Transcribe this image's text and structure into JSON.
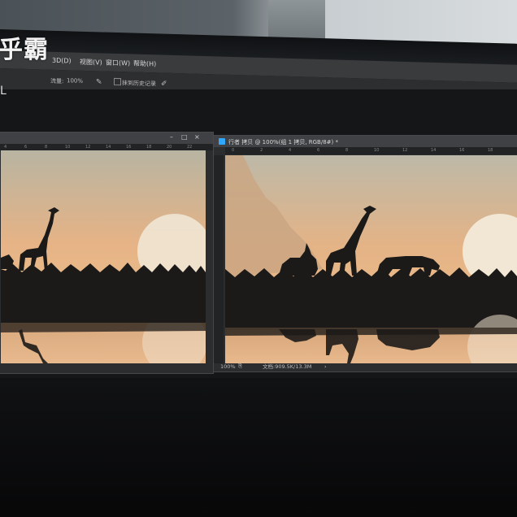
{
  "brand": {
    "title": "乎霸",
    "subtitle": "L"
  },
  "menu": {
    "items": [
      {
        "label": "3D(D)"
      },
      {
        "label": "视图(V)"
      },
      {
        "label": "窗口(W)"
      },
      {
        "label": "帮助(H)"
      }
    ]
  },
  "options": {
    "flow_label": "流量:",
    "flow_value": "100%",
    "history_label": "抹到历史记录"
  },
  "doc_right": {
    "title": "行者 拷贝 @ 100%(组 1 拷贝, RGB/8#) *",
    "zoom": "100%",
    "doc_size": "文档:909.5K/13.3M",
    "ruler_ticks": [
      "0",
      "2",
      "4",
      "6",
      "8",
      "10",
      "12",
      "14",
      "16",
      "18"
    ]
  },
  "doc_left": {
    "ruler_ticks": [
      "4",
      "6",
      "8",
      "10",
      "12",
      "14",
      "16",
      "18",
      "20",
      "22"
    ]
  },
  "colors": {
    "sky_top": "#b9b7a9",
    "sky_horizon": "#e9b888",
    "sun": "#f1e9d8",
    "silhouette": "#1c1a18",
    "ps_blue": "#31a8ff"
  }
}
